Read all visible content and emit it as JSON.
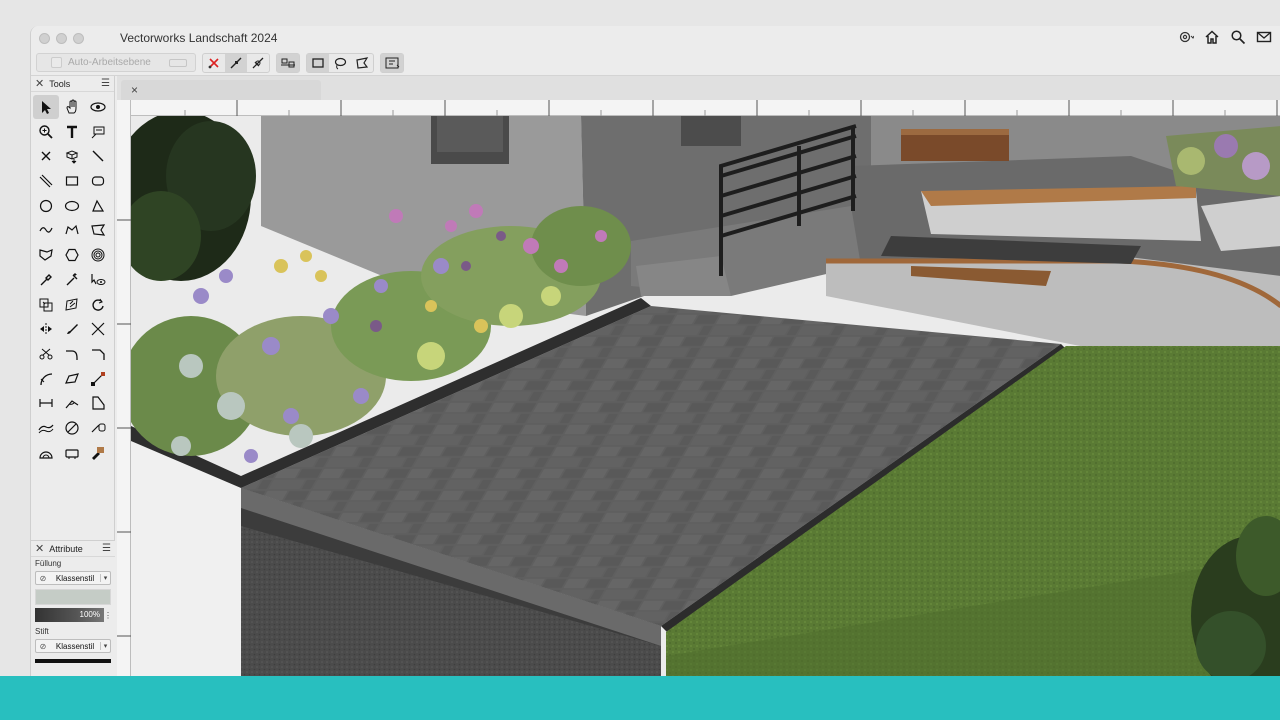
{
  "window": {
    "title": "Vectorworks Landschaft 2024"
  },
  "titlebar_icons": [
    "gear-icon",
    "home-icon",
    "search-icon",
    "mail-icon"
  ],
  "toolbar": {
    "auto_workplane_label": "Auto-Arbeitsebene",
    "buttons": [
      "no-snap-icon",
      "snap-line-icon",
      "snap-diagonal-icon",
      "align-icon",
      "rectangle-select-icon",
      "lasso-select-icon",
      "polygon-select-icon",
      "layout-icon"
    ]
  },
  "tools_palette": {
    "title": "Tools",
    "tools": [
      "selection-icon",
      "pan-icon",
      "flyover-icon",
      "zoom-icon",
      "text-icon",
      "callout-icon",
      "locus-icon",
      "stake-icon",
      "line-icon",
      "double-line-icon",
      "rectangle-icon",
      "rounded-rectangle-icon",
      "circle-icon",
      "oval-icon",
      "triangle-icon",
      "freehand-icon",
      "polyline-icon",
      "polygon-icon",
      "3d-polygon-icon",
      "hexagon-icon",
      "spiral-icon",
      "eyedropper-icon",
      "attribute-mapping-icon",
      "visibility-icon",
      "offset-icon",
      "mirror-icon",
      "rotate-icon",
      "split-icon",
      "brush-icon",
      "trim-icon",
      "scissors-icon",
      "fillet-icon",
      "chamfer-icon",
      "arc-icon",
      "shape-icon",
      "connect-icon",
      "dimension-icon",
      "angle-icon",
      "area-icon",
      "wave-icon",
      "diameter-icon",
      "measure-icon",
      "protractor-icon",
      "tape-icon",
      "paint-icon"
    ]
  },
  "attributes_palette": {
    "title": "Attribute",
    "fill_label": "Füllung",
    "fill_style": "Klassenstil",
    "fill_color": "#c5ccc6",
    "opacity": "100%",
    "pen_label": "Stift",
    "pen_style": "Klassenstil"
  },
  "document": {
    "tab_close": "×"
  },
  "accent_color": "#28bfbf"
}
